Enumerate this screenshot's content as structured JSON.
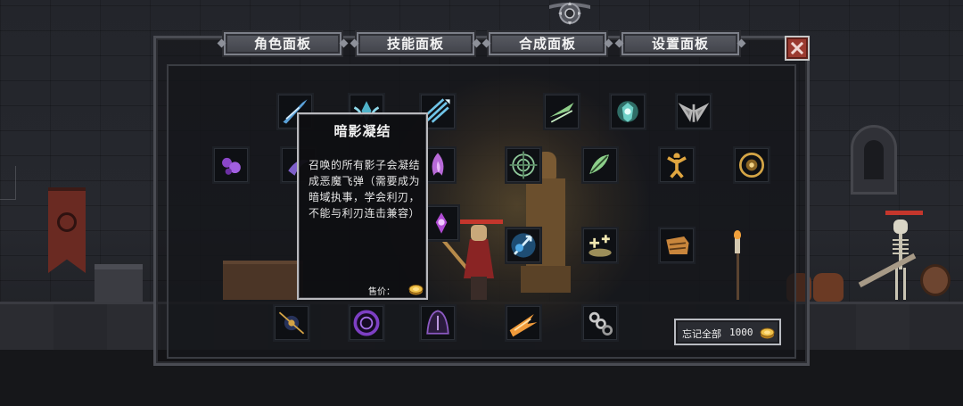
{
  "tabs": [
    {
      "label": "角色面板"
    },
    {
      "label": "技能面板"
    },
    {
      "label": "合成面板"
    },
    {
      "label": "设置面板"
    }
  ],
  "tooltip": {
    "title": "暗影凝结",
    "description": "召唤的所有影子会凝结成恶魔飞弹（需要成为暗域执事，学会利刃，不能与利刃连击兼容）",
    "price_label": "售价：",
    "price_icon": "gold-coin-icon"
  },
  "forget_all": {
    "label": "忘记全部",
    "cost": "1000",
    "icon": "gold-coin-icon"
  },
  "close_icon": "close-icon",
  "skills": [
    {
      "icon": "blade-slash-skill-icon",
      "color": "#5aa0d8"
    },
    {
      "icon": "frost-wing-skill-icon",
      "color": "#4fb2c9"
    },
    {
      "icon": "arrow-volley-skill-icon",
      "color": "#6fc4e8"
    },
    {
      "icon": "wind-blades-skill-icon",
      "color": "#8fcf8a"
    },
    {
      "icon": "spirit-shield-skill-icon",
      "color": "#6fd0c7"
    },
    {
      "icon": "dark-wings-skill-icon",
      "color": "#b5b5b5"
    },
    {
      "icon": "shadow-orb-skill-icon",
      "color": "#8b47c9"
    },
    {
      "icon": "void-mist-skill-icon",
      "color": "#7e5fc9"
    },
    {
      "icon": "demon-flame-skill-icon",
      "color": "#b86ad8"
    },
    {
      "icon": "target-sigil-skill-icon",
      "color": "#8ec89a"
    },
    {
      "icon": "twin-leaf-skill-icon",
      "color": "#8ccf8a"
    },
    {
      "icon": "berserk-strength-skill-icon",
      "color": "#e0a640"
    },
    {
      "icon": "golden-aura-skill-icon",
      "color": "#d4a546"
    },
    {
      "icon": "shadow-summon-skill-icon",
      "color": "#b04bd4"
    },
    {
      "icon": "spirit-arrow-skill-icon",
      "color": "#4fa9e6"
    },
    {
      "icon": "holy-plus-skill-icon",
      "color": "#f0e6b0"
    },
    {
      "icon": "iron-fist-skill-icon",
      "color": "#c9863c"
    },
    {
      "icon": "chain-orb-skill-icon",
      "color": "#d3a245"
    },
    {
      "icon": "dark-portal-skill-icon",
      "color": "#7d3fc4"
    },
    {
      "icon": "shade-cloak-skill-icon",
      "color": "#8c5ac2"
    },
    {
      "icon": "fire-slash-skill-icon",
      "color": "#f09a3a"
    },
    {
      "icon": "bone-chain-skill-icon",
      "color": "#c8c8c8"
    }
  ]
}
